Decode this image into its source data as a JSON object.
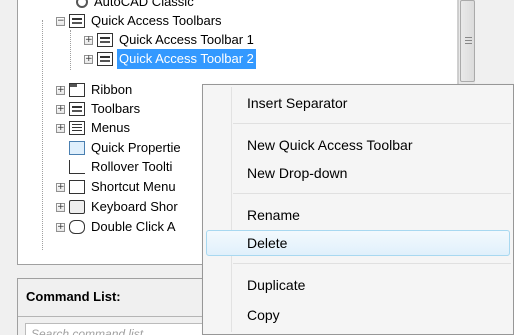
{
  "tree": {
    "items": [
      {
        "label": "AutoCAD Classic",
        "icon": "gear-icon",
        "selected": false
      },
      {
        "label": "Quick Access Toolbars",
        "icon": "toolbar-group-icon",
        "expander": "−",
        "selected": false
      },
      {
        "label": "Quick Access Toolbar 1",
        "icon": "toolbar-icon",
        "expander": "+",
        "selected": false
      },
      {
        "label": "Quick Access Toolbar 2",
        "icon": "toolbar-icon",
        "expander": "+",
        "selected": true
      },
      {
        "label": "Ribbon",
        "icon": "ribbon-icon",
        "expander": "+",
        "selected": false
      },
      {
        "label": "Toolbars",
        "icon": "toolbars-icon",
        "expander": "+",
        "selected": false
      },
      {
        "label": "Menus",
        "icon": "menu-icon",
        "expander": "+",
        "selected": false
      },
      {
        "label": "Quick Propertie",
        "icon": "quick-properties-icon",
        "selected": false
      },
      {
        "label": "Rollover Toolti",
        "icon": "rollover-tooltip-icon",
        "selected": false
      },
      {
        "label": "Shortcut Menu",
        "icon": "shortcut-menu-icon",
        "expander": "+",
        "selected": false
      },
      {
        "label": "Keyboard Shor",
        "icon": "keyboard-shortcut-icon",
        "expander": "+",
        "selected": false
      },
      {
        "label": "Double Click A",
        "icon": "double-click-icon",
        "expander": "+",
        "selected": false
      }
    ]
  },
  "command_list": {
    "title": "Command List:",
    "search_placeholder": "Search command list"
  },
  "context_menu": {
    "items": [
      {
        "label": "Insert Separator"
      },
      {
        "label": "New Quick Access Toolbar"
      },
      {
        "label": "New Drop-down"
      },
      {
        "label": "Rename"
      },
      {
        "label": "Delete",
        "hovered": true
      },
      {
        "label": "Duplicate"
      },
      {
        "label": "Copy"
      }
    ]
  },
  "colors": {
    "selection": "#3399ff",
    "hover_border": "#a8d8f0"
  }
}
